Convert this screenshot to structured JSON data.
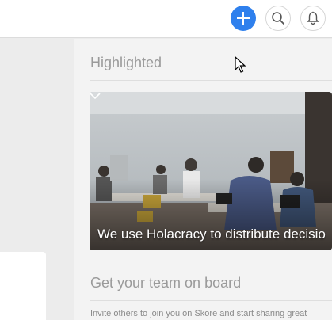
{
  "header": {
    "icons": [
      "plus-icon",
      "search-icon",
      "bell-icon"
    ],
    "accent_color": "#2f80ed"
  },
  "highlighted": {
    "title": "Highlighted",
    "card": {
      "caption": "We use Holacracy to distribute decisio",
      "icon": "chevron-down-icon"
    }
  },
  "team": {
    "title": "Get your team on board",
    "invite_text": "Invite others to join you on Skore and start sharing great"
  }
}
